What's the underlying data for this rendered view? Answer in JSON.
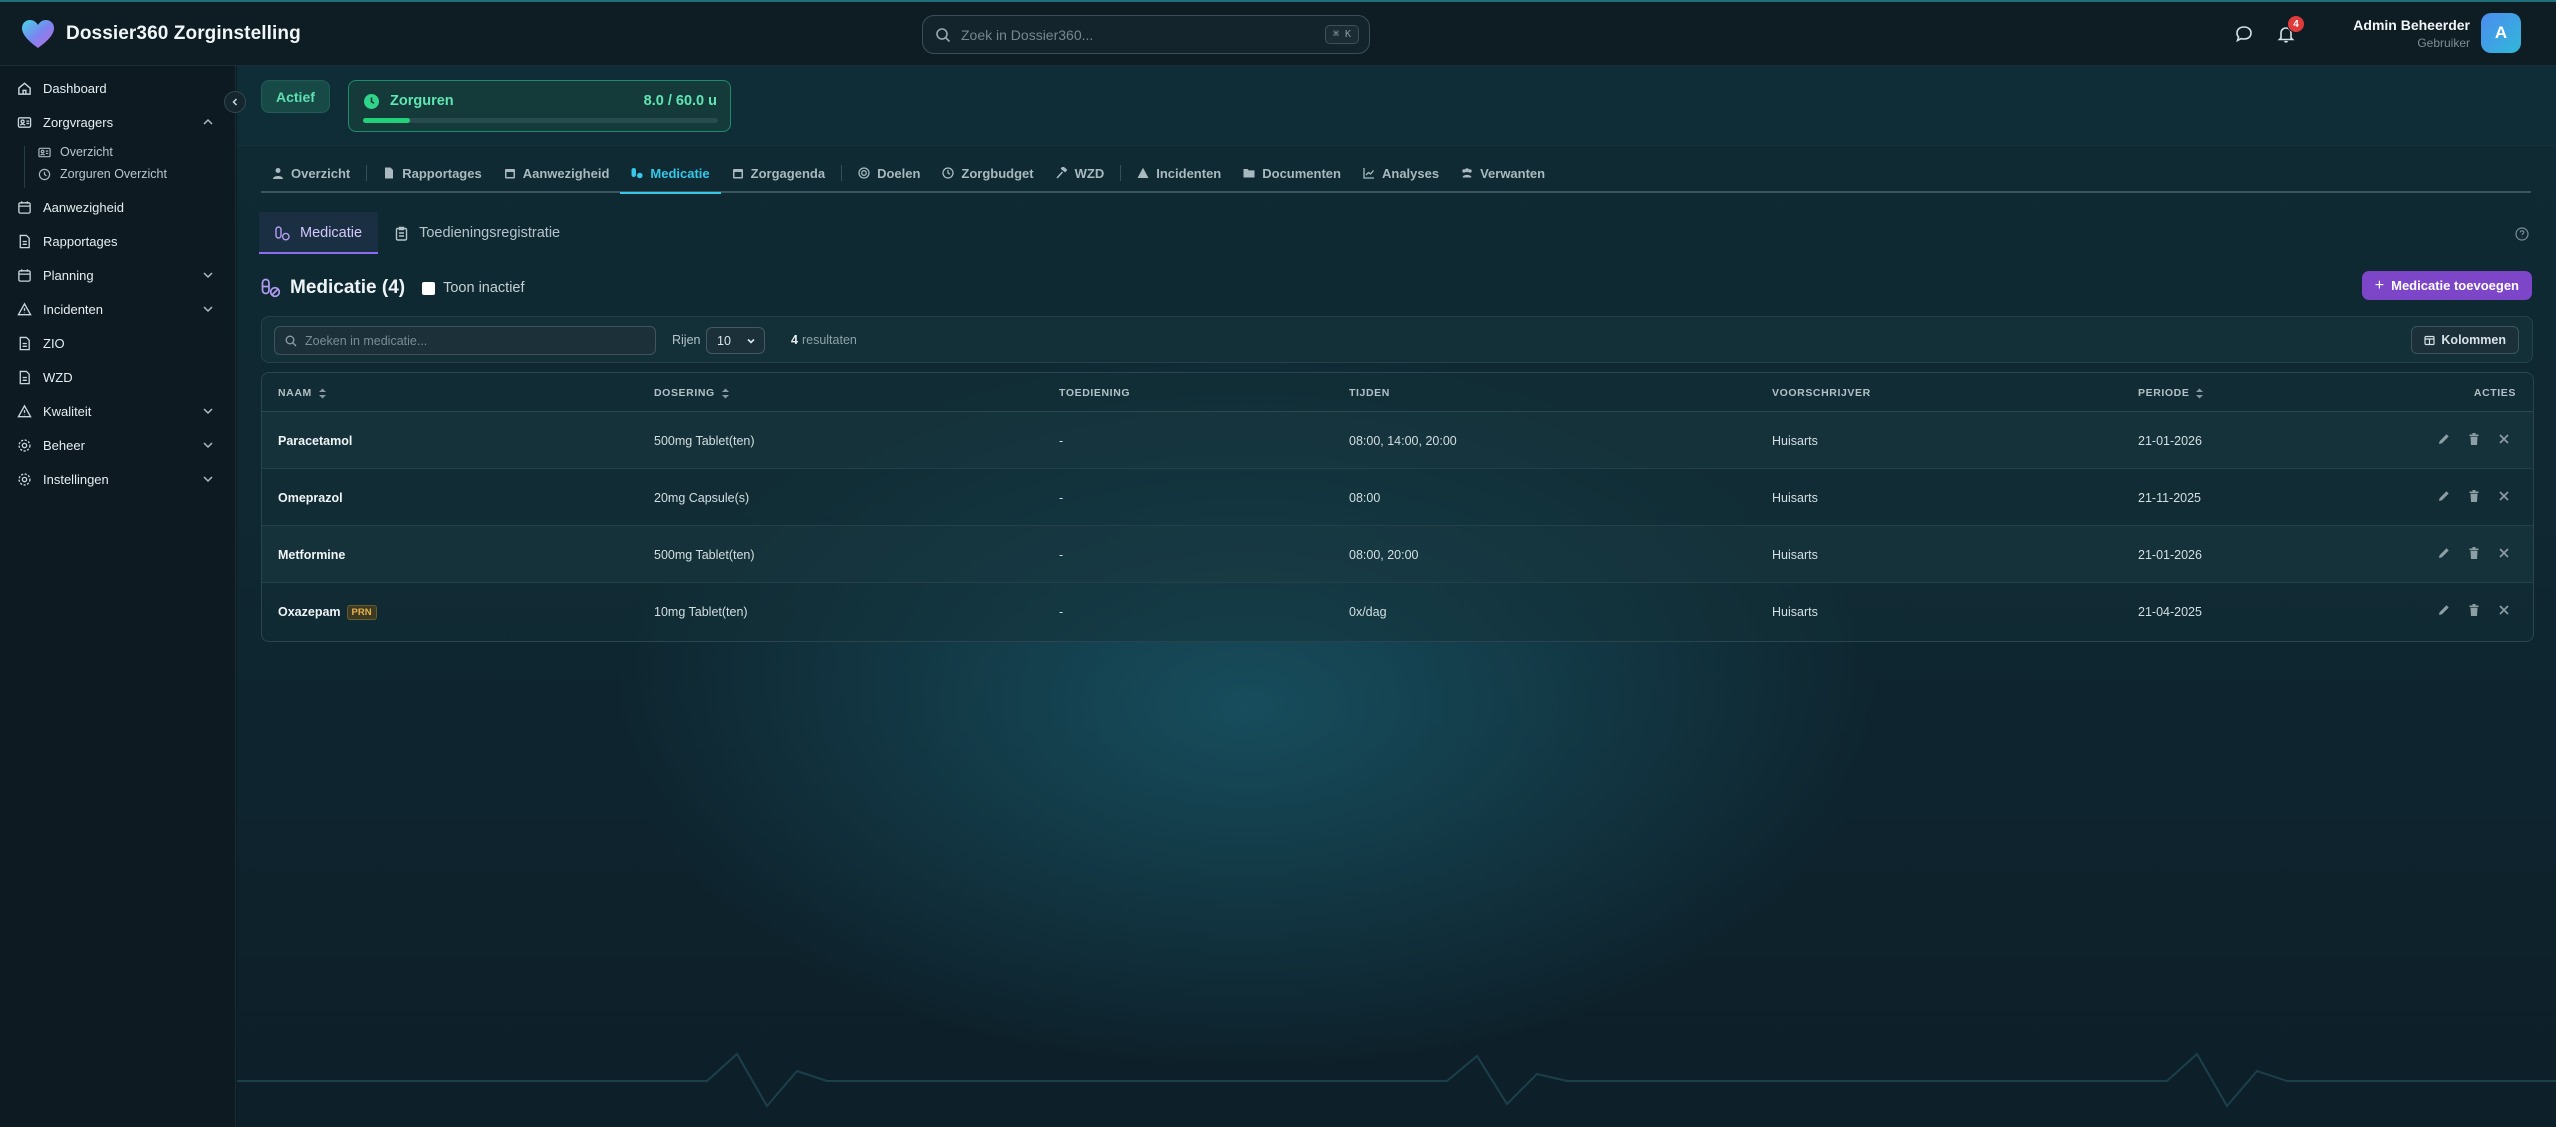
{
  "app": {
    "title": "Dossier360 Zorginstelling"
  },
  "search": {
    "placeholder": "Zoek in Dossier360...",
    "shortcut": "⌘ K"
  },
  "notifications": {
    "count": "4"
  },
  "user": {
    "name": "Admin Beheerder",
    "role": "Gebruiker",
    "initial": "A"
  },
  "sidebar": {
    "items": [
      {
        "label": "Dashboard",
        "icon": "home-icon"
      },
      {
        "label": "Zorgvragers",
        "icon": "users-icon",
        "expanded": true
      },
      {
        "label": "Aanwezigheid",
        "icon": "calendar-check-icon"
      },
      {
        "label": "Rapportages",
        "icon": "file-text-icon"
      },
      {
        "label": "Planning",
        "icon": "calendar-icon",
        "expandable": true
      },
      {
        "label": "Incidenten",
        "icon": "warning-icon",
        "expandable": true
      },
      {
        "label": "ZIO",
        "icon": "document-icon"
      },
      {
        "label": "WZD",
        "icon": "document-icon"
      },
      {
        "label": "Kwaliteit",
        "icon": "triangle-icon",
        "expandable": true
      },
      {
        "label": "Beheer",
        "icon": "gear-icon",
        "expandable": true
      },
      {
        "label": "Instellingen",
        "icon": "gear-icon",
        "expandable": true
      }
    ],
    "subitems": [
      {
        "label": "Overzicht",
        "icon": "users-icon"
      },
      {
        "label": "Zorguren Overzicht",
        "icon": "clock-icon"
      }
    ]
  },
  "client": {
    "status": "Actief",
    "hours": {
      "label": "Zorguren",
      "value": "8.0 / 60.0 u",
      "used": 8.0,
      "total": 60.0
    }
  },
  "tabs": [
    {
      "label": "Overzicht",
      "icon": "user-icon"
    },
    {
      "label": "Rapportages",
      "icon": "file-icon"
    },
    {
      "label": "Aanwezigheid",
      "icon": "calendar-icon"
    },
    {
      "label": "Medicatie",
      "icon": "pills-icon",
      "active": true
    },
    {
      "label": "Zorgagenda",
      "icon": "calendar-icon"
    },
    {
      "label": "Doelen",
      "icon": "target-icon"
    },
    {
      "label": "Zorgbudget",
      "icon": "clock-icon"
    },
    {
      "label": "WZD",
      "icon": "gavel-icon"
    },
    {
      "label": "Incidenten",
      "icon": "warning-icon"
    },
    {
      "label": "Documenten",
      "icon": "folder-icon"
    },
    {
      "label": "Analyses",
      "icon": "chart-icon"
    },
    {
      "label": "Verwanten",
      "icon": "people-icon"
    }
  ],
  "subtabs": [
    {
      "label": "Medicatie",
      "active": true
    },
    {
      "label": "Toedieningsregistratie",
      "active": false
    }
  ],
  "medication": {
    "title": "Medicatie (4)",
    "show_inactive_label": "Toon inactief",
    "add_label": "Medicatie toevoegen",
    "search_placeholder": "Zoeken in medicatie...",
    "rows_label": "Rijen",
    "rows_value": "10",
    "results_count": "4",
    "results_label": "resultaten",
    "columns_label": "Kolommen",
    "columns": [
      "NAAM",
      "DOSERING",
      "TOEDIENING",
      "TIJDEN",
      "VOORSCHRIJVER",
      "PERIODE",
      "ACTIES"
    ],
    "rows": [
      {
        "naam": "Paracetamol",
        "badge": "",
        "dosering": "500mg Tablet(ten)",
        "toediening": "-",
        "tijden": "08:00, 14:00, 20:00",
        "voorschrijver": "Huisarts",
        "periode": "21-01-2026"
      },
      {
        "naam": "Omeprazol",
        "badge": "",
        "dosering": "20mg Capsule(s)",
        "toediening": "-",
        "tijden": "08:00",
        "voorschrijver": "Huisarts",
        "periode": "21-11-2025"
      },
      {
        "naam": "Metformine",
        "badge": "",
        "dosering": "500mg Tablet(ten)",
        "toediening": "-",
        "tijden": "08:00, 20:00",
        "voorschrijver": "Huisarts",
        "periode": "21-01-2026"
      },
      {
        "naam": "Oxazepam",
        "badge": "PRN",
        "dosering": "10mg Tablet(ten)",
        "toediening": "-",
        "tijden": "0x/dag",
        "voorschrijver": "Huisarts",
        "periode": "21-04-2025"
      }
    ]
  },
  "colors": {
    "accent": "#35c8e8",
    "primary_button": "#7d46c8",
    "success": "#22d07a",
    "badge": "#e03b3b"
  }
}
